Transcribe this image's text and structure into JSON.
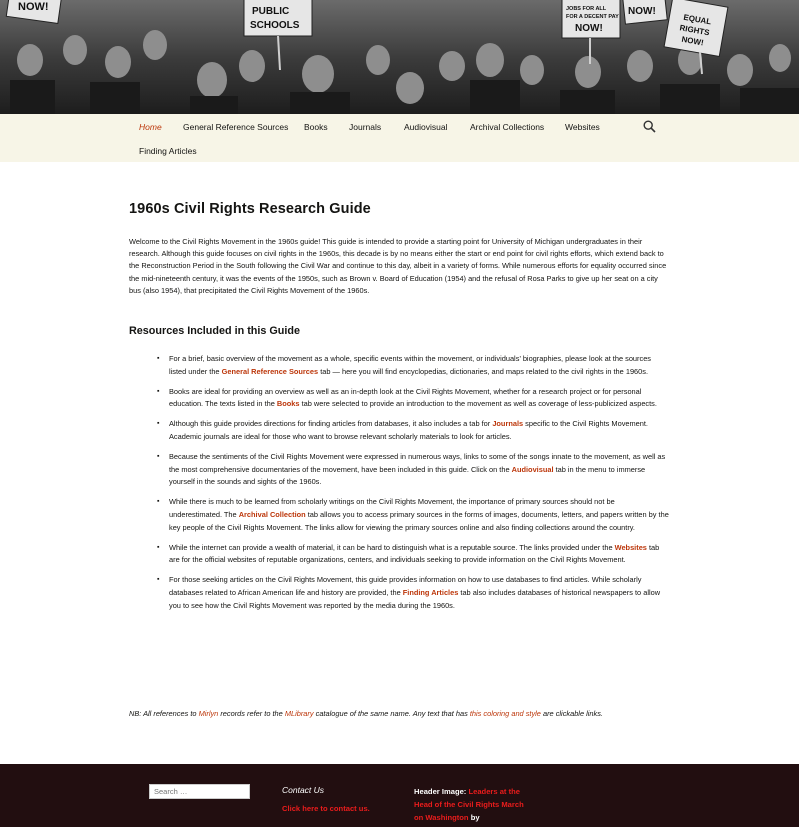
{
  "colors": {
    "accent": "#bc360a",
    "nav_bg": "#f7f5e7",
    "footer_bg": "#220e10",
    "footer_link": "#ea1c1c"
  },
  "banner": {
    "signs": [
      "NOW!",
      "PUBLIC SCHOOLS",
      "JOBS FOR ALL FOR A DECENT PAY NOW!",
      "NOW!",
      "DEMAND EQUAL RIGHTS NOW!"
    ]
  },
  "nav": {
    "items": [
      "Home",
      "General Reference Sources",
      "Books",
      "Journals",
      "Audiovisual",
      "Archival Collections",
      "Websites",
      "Finding Articles"
    ],
    "active_index": 0,
    "search_icon": "search-icon"
  },
  "page": {
    "title": "1960s Civil Rights Research Guide",
    "intro": "Welcome to the Civil Rights Movement in the 1960s guide! This guide is intended to provide a starting point for University of Michigan undergraduates in their research. Although this guide focuses on civil rights in the 1960s, this decade is by no means either the start or end point for civil rights efforts, which extend back to the Reconstruction Period in the South following the Civil War and continue to this day, albeit in a variety of forms. While numerous efforts for equality occurred since the mid-nineteenth century, it was the events of the 1950s, such as Brown v. Board of Education (1954) and the refusal of Rosa Parks to give up her seat on a city bus (also 1954), that precipitated the Civil Rights Movement of the 1960s.",
    "subheading": "Resources Included in this Guide",
    "resources": [
      {
        "before": "For a brief, basic overview of the movement as a whole, specific events within the movement, or individuals’ biographies, please look at the sources listed under the ",
        "link": "General Reference Sources",
        "after": " tab — here you will find encyclopedias, dictionaries, and maps related to the civil rights in the 1960s."
      },
      {
        "before": "Books are ideal for providing  an overview as well as an in-depth look at the Civil Rights Movement, whether for a research project or for personal education. The texts listed in the ",
        "link": "Books",
        "after": " tab were selected to provide an introduction to the movement as well as coverage of less-publicized aspects."
      },
      {
        "before": "Although this guide provides directions for finding articles from databases, it also includes a tab for ",
        "link": "Journals",
        "after": " specific to the Civil Rights Movement. Academic journals are ideal for those who want to browse relevant scholarly materials to look for articles."
      },
      {
        "before": "Because the sentiments of the Civil Rights Movement were expressed in numerous ways, links to some of the songs innate to the movement, as well as the most comprehensive documentaries of the movement, have been included in this guide. Click on the ",
        "link": "Audiovisual",
        "after": " tab in the menu to immerse yourself in the sounds and sights of the 1960s."
      },
      {
        "before": "While there is much to be learned from scholarly writings on the Civil Rights Movement, the importance of primary sources should not be underestimated. The ",
        "link": "Archival Collection",
        "after": " tab allows you to access primary sources in the forms of images, documents, letters, and papers written by the key people of the Civil Rights Movement. The links allow for viewing the primary sources online  and also finding collections around the country."
      },
      {
        "before": "While the internet can provide a wealth of material, it can be hard to distinguish what is a reputable source. The links provided under the ",
        "link": "Websites",
        "after": " tab are for the official websites of reputable organizations, centers, and individuals seeking to provide information on the Civil Rights Movement."
      },
      {
        "before": "For those seeking articles on the Civil Rights Movement, this guide provides information on how to use databases to find articles. While scholarly databases related to African American life and history are provided, the ",
        "link": "Finding Articles",
        "after": " tab also includes databases of historical newspapers to allow you to see how the Civil Rights Movement was reported by the media during the 1960s."
      }
    ],
    "note": {
      "p1": "NB: All references to ",
      "link1": "Mirlyn",
      "p2": " records refer to the ",
      "link2": "MLibrary",
      "p3": " catalogue of the same name. Any text that has ",
      "link3": "this coloring and style",
      "p4": " are clickable links."
    }
  },
  "footer": {
    "search_placeholder": "Search …",
    "contact_heading": "Contact Us",
    "contact_link": "Click here to contact us.",
    "header_image_label": "Header Image:",
    "header_image_link": "Leaders at the Head of the Civil Rights March on Washington",
    "header_image_by": "by"
  }
}
